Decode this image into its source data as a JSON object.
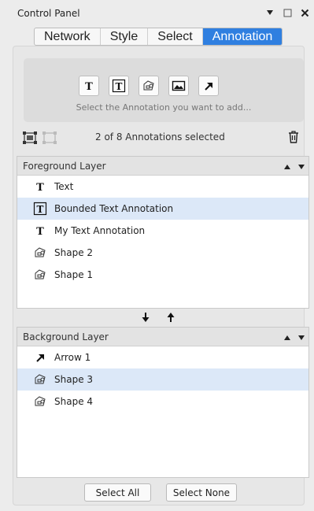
{
  "window": {
    "title": "Control Panel"
  },
  "tabs": [
    {
      "label": "Network",
      "active": false
    },
    {
      "label": "Style",
      "active": false
    },
    {
      "label": "Select",
      "active": false
    },
    {
      "label": "Annotation",
      "active": true
    }
  ],
  "palette": {
    "tools": [
      "text-tool-icon",
      "bounded-text-tool-icon",
      "shape-tool-icon",
      "image-tool-icon",
      "arrow-tool-icon"
    ],
    "hint": "Select the Annotation you want to add..."
  },
  "selection": {
    "count_text": "2 of 8 Annotations selected"
  },
  "foreground": {
    "title": "Foreground Layer",
    "items": [
      {
        "label": "Text",
        "icon": "text-icon",
        "selected": false
      },
      {
        "label": "Bounded Text Annotation",
        "icon": "bounded-text-icon",
        "selected": true
      },
      {
        "label": "My Text Annotation",
        "icon": "text-icon",
        "selected": false
      },
      {
        "label": "Shape 2",
        "icon": "shape-icon",
        "selected": false
      },
      {
        "label": "Shape 1",
        "icon": "shape-icon",
        "selected": false
      }
    ]
  },
  "background": {
    "title": "Background Layer",
    "items": [
      {
        "label": "Arrow 1",
        "icon": "arrow-icon",
        "selected": false
      },
      {
        "label": "Shape 3",
        "icon": "shape-icon",
        "selected": true
      },
      {
        "label": "Shape 4",
        "icon": "shape-icon",
        "selected": false
      }
    ]
  },
  "buttons": {
    "select_all": "Select All",
    "select_none": "Select None"
  },
  "colors": {
    "accent": "#2f7fe0",
    "selected_row": "#dce8f8"
  }
}
